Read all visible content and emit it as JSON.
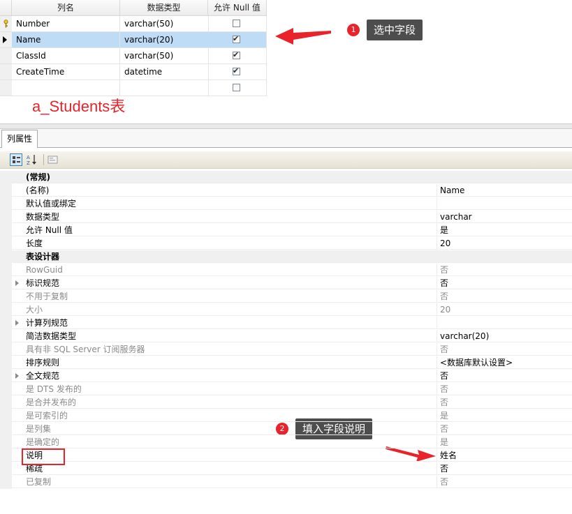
{
  "columns_grid": {
    "headers": [
      "列名",
      "数据类型",
      "允许 Null 值"
    ],
    "rows": [
      {
        "name": "Number",
        "type": "varchar(50)",
        "nullable": false,
        "icon": "primary-key-icon"
      },
      {
        "name": "Name",
        "type": "varchar(20)",
        "nullable": true,
        "icon": "current-row-arrow-icon",
        "selected": true
      },
      {
        "name": "ClassId",
        "type": "varchar(50)",
        "nullable": true
      },
      {
        "name": "CreateTime",
        "type": "datetime",
        "nullable": true
      },
      {
        "name": "",
        "type": "",
        "nullable": false
      }
    ]
  },
  "table_label": "a_Students表",
  "annotations": {
    "step1": {
      "number": "1",
      "text": "选中字段"
    },
    "step2": {
      "number": "2",
      "text": "填入字段说明"
    }
  },
  "properties_panel": {
    "tab_label": "列属性",
    "toolbar_icons": [
      "categorized-icon",
      "alphabetical-sort-icon",
      "property-pages-icon"
    ],
    "rows": [
      {
        "kind": "category",
        "name": "(常规)",
        "value": ""
      },
      {
        "kind": "prop",
        "name": "(名称)",
        "value": "Name"
      },
      {
        "kind": "prop",
        "name": "默认值或绑定",
        "value": ""
      },
      {
        "kind": "prop",
        "name": "数据类型",
        "value": "varchar"
      },
      {
        "kind": "prop",
        "name": "允许 Null 值",
        "value": "是"
      },
      {
        "kind": "prop",
        "name": "长度",
        "value": "20"
      },
      {
        "kind": "category",
        "name": "表设计器",
        "value": ""
      },
      {
        "kind": "gray",
        "name": "RowGuid",
        "value": "否"
      },
      {
        "kind": "expand",
        "name": "标识规范",
        "value": "否"
      },
      {
        "kind": "gray",
        "name": "不用于复制",
        "value": "否"
      },
      {
        "kind": "gray",
        "name": "大小",
        "value": "20"
      },
      {
        "kind": "expand",
        "name": "计算列规范",
        "value": ""
      },
      {
        "kind": "prop",
        "name": "简洁数据类型",
        "value": "varchar(20)"
      },
      {
        "kind": "gray",
        "name": "具有非 SQL Server 订阅服务器",
        "value": "否"
      },
      {
        "kind": "prop",
        "name": "排序规则",
        "value": "<数据库默认设置>"
      },
      {
        "kind": "expand",
        "name": "全文规范",
        "value": "否"
      },
      {
        "kind": "gray",
        "name": "是 DTS 发布的",
        "value": "否"
      },
      {
        "kind": "gray",
        "name": "是合并发布的",
        "value": "否"
      },
      {
        "kind": "gray",
        "name": "是可索引的",
        "value": "是"
      },
      {
        "kind": "gray",
        "name": "是列集",
        "value": "否"
      },
      {
        "kind": "gray",
        "name": "是确定的",
        "value": "是"
      },
      {
        "kind": "prop",
        "name": "说明",
        "value": "姓名"
      },
      {
        "kind": "prop",
        "name": "稀疏",
        "value": "否"
      },
      {
        "kind": "gray",
        "name": "已复制",
        "value": "否"
      }
    ]
  },
  "colors": {
    "annotation_red": "#e8232a",
    "callout_bg": "#4d4d4d",
    "selected_row": "#bfdcf7"
  }
}
